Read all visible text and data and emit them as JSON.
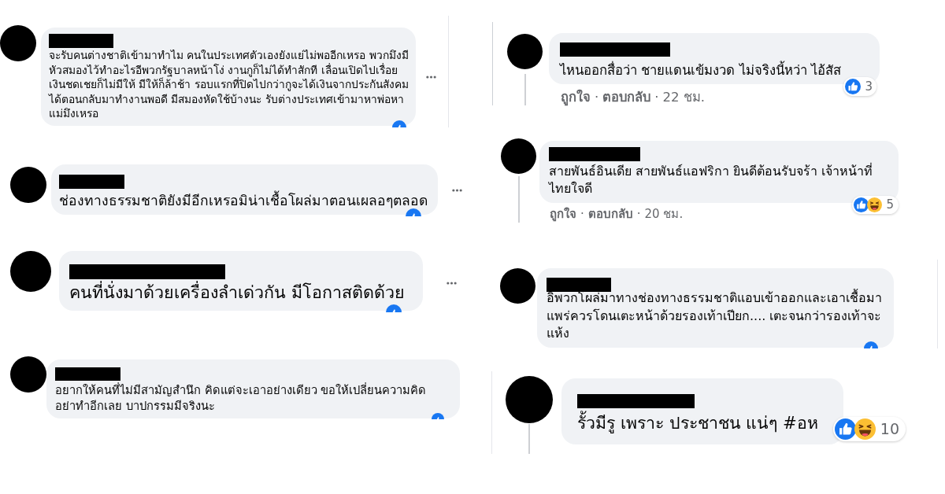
{
  "left_column": [
    {
      "text": "จะรับคนต่างชาติเข้ามาทำไม คนในประเทศตัวเองยังแย่ไม่พออีกเหรอ พวกมึงมีหัวสมองไว้ทำอะไรอีพวกรัฐบาลหน้าโง่ งานกูก็ไม่ได้ทำสักที เลื่อนเปิดไปเรื่อยเงินชดเชยก็ไม่มีให้ มีให้ก็ล้าช้า รอบแรกที่ปิดไปกว่ากูจะได้เงินจากประกันสังคมได้ตอนกลับมาทำงานพอดี มีสมองหัดใช้บ้างนะ รับต่างประเทศเข้ามาหาพ่อหาแม่มึงเหรอ",
      "reactions": [
        {
          "kind": "like"
        }
      ],
      "more_button": true
    },
    {
      "text": "ช่องทางธรรมชาติยังมีอีกเหรอมิน่าเชื้อโผล่มาตอนเผลอๆตลอด",
      "reactions": [
        {
          "kind": "like"
        }
      ],
      "more_button": true
    },
    {
      "text": "คนที่นั่งมาด้วยเครื่องลำเด่วกัน มีโอกาสติดด้วย",
      "reactions": [
        {
          "kind": "like"
        }
      ],
      "more_button": true
    },
    {
      "text": "อยากให้คนที่ไม่มีสามัญสำนึก คิดแต่จะเอาอย่างเดียว ขอให้เปลี่ยนความคิด อย่าทำอีกเลย บาปกรรมมีจริงนะ",
      "reactions": [
        {
          "kind": "like"
        }
      ]
    }
  ],
  "right_column": [
    {
      "text": "ไหนออกสื่อว่า ชายแดนเข้มงวด ไม่จริงนี้หว่า ไอ้สัส",
      "reactions": [
        {
          "kind": "like"
        }
      ],
      "reaction_count": "3",
      "actions": [
        {
          "kind": "like",
          "text": "ถูกใจ"
        },
        {
          "kind": "separator",
          "text": "·"
        },
        {
          "kind": "reply",
          "text": "ตอบกลับ"
        },
        {
          "kind": "separator",
          "text": "·"
        },
        {
          "kind": "time",
          "text": "22 ชม."
        }
      ]
    },
    {
      "text": "สายพันธ์อินเดีย สายพันธ์แอฟริกา ยินดีต้อนรับจร้า เจ้าหน้าที่ไทยใจดี",
      "reactions": [
        {
          "kind": "like"
        },
        {
          "kind": "haha"
        }
      ],
      "reaction_count": "5",
      "actions": [
        {
          "kind": "like",
          "text": "ถูกใจ"
        },
        {
          "kind": "separator",
          "text": "·"
        },
        {
          "kind": "reply",
          "text": "ตอบกลับ"
        },
        {
          "kind": "separator",
          "text": "·"
        },
        {
          "kind": "time",
          "text": "20 ชม."
        }
      ]
    },
    {
      "text": "อิพวกโผล่มาทางช่องทางธรรมชาติแอบเข้าออกและเอาเชื้อมาแพร่ควรโดนเตะหน้าด้วยรองเท้าเปียก.... เตะจนกว่ารองเท้าจะแห้ง",
      "reactions": [
        {
          "kind": "like"
        }
      ]
    },
    {
      "text": "รั้วมีรู เพราะ ประชาชน แน่ๆ #อห",
      "reactions": [
        {
          "kind": "like"
        },
        {
          "kind": "haha"
        }
      ],
      "reaction_count": "10"
    }
  ]
}
